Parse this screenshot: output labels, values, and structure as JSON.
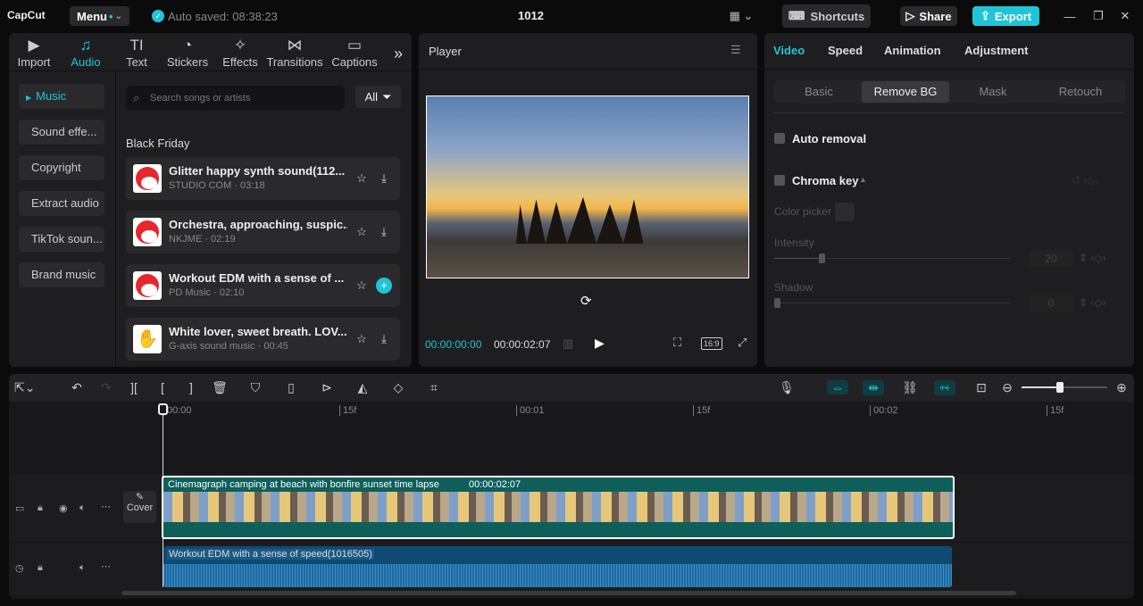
{
  "app": {
    "logo": "CapCut",
    "menu": "Menu",
    "autosave": "Auto saved: 08:38:23",
    "project": "1012",
    "shortcuts": "Shortcuts",
    "share": "Share",
    "export": "Export"
  },
  "tabs": [
    {
      "label": "Import",
      "icon": "▶"
    },
    {
      "label": "Audio",
      "icon": "♫"
    },
    {
      "label": "Text",
      "icon": "TI"
    },
    {
      "label": "Stickers",
      "icon": "◔"
    },
    {
      "label": "Effects",
      "icon": "✧"
    },
    {
      "label": "Transitions",
      "icon": "⋈"
    },
    {
      "label": "Captions",
      "icon": "▭"
    }
  ],
  "sidebar": [
    "Music",
    "Sound effe...",
    "Copyright",
    "Extract audio",
    "TikTok soun...",
    "Brand music"
  ],
  "search": {
    "placeholder": "Search songs or artists",
    "filter": "All"
  },
  "section": "Black Friday",
  "songs": [
    {
      "title": "Glitter happy synth sound(112...",
      "sub": "STUDIO COM · 03:18"
    },
    {
      "title": "Orchestra, approaching, suspic...",
      "sub": "NKJME · 02:19"
    },
    {
      "title": "Workout EDM with a sense of ...",
      "sub": "PD Music · 02:10"
    },
    {
      "title": "White lover, sweet breath. LOV...",
      "sub": "G-axis sound music · 00:45"
    }
  ],
  "player": {
    "title": "Player",
    "current": "00:00:00:00",
    "total": "00:00:02:07",
    "ratio": "16:9"
  },
  "right": {
    "tabs": [
      "Video",
      "Speed",
      "Animation",
      "Adjustment"
    ],
    "sub_tabs": [
      "Basic",
      "Remove BG",
      "Mask",
      "Retouch"
    ],
    "auto_removal": "Auto removal",
    "chroma_key": "Chroma key",
    "color_picker": "Color picker",
    "intensity": "Intensity",
    "intensity_value": "20",
    "intensity_fraction": 0.2,
    "shadow": "Shadow",
    "shadow_value": "0",
    "shadow_fraction": 0
  },
  "timeline": {
    "ticks": [
      "00:00",
      "15f",
      "00:01",
      "15f",
      "00:02",
      "15f"
    ],
    "cover": "Cover",
    "video_clip": "Cinemagraph camping at beach with bonfire sunset time lapse",
    "video_duration": "00:00:02:07",
    "audio_clip": "Workout EDM with a sense of speed(1016505)",
    "zoom_fraction": 0.45
  },
  "colors": {
    "accent": "#1fc5d6",
    "video_track": "#0e5f5a",
    "audio_track": "#0f4a73"
  }
}
